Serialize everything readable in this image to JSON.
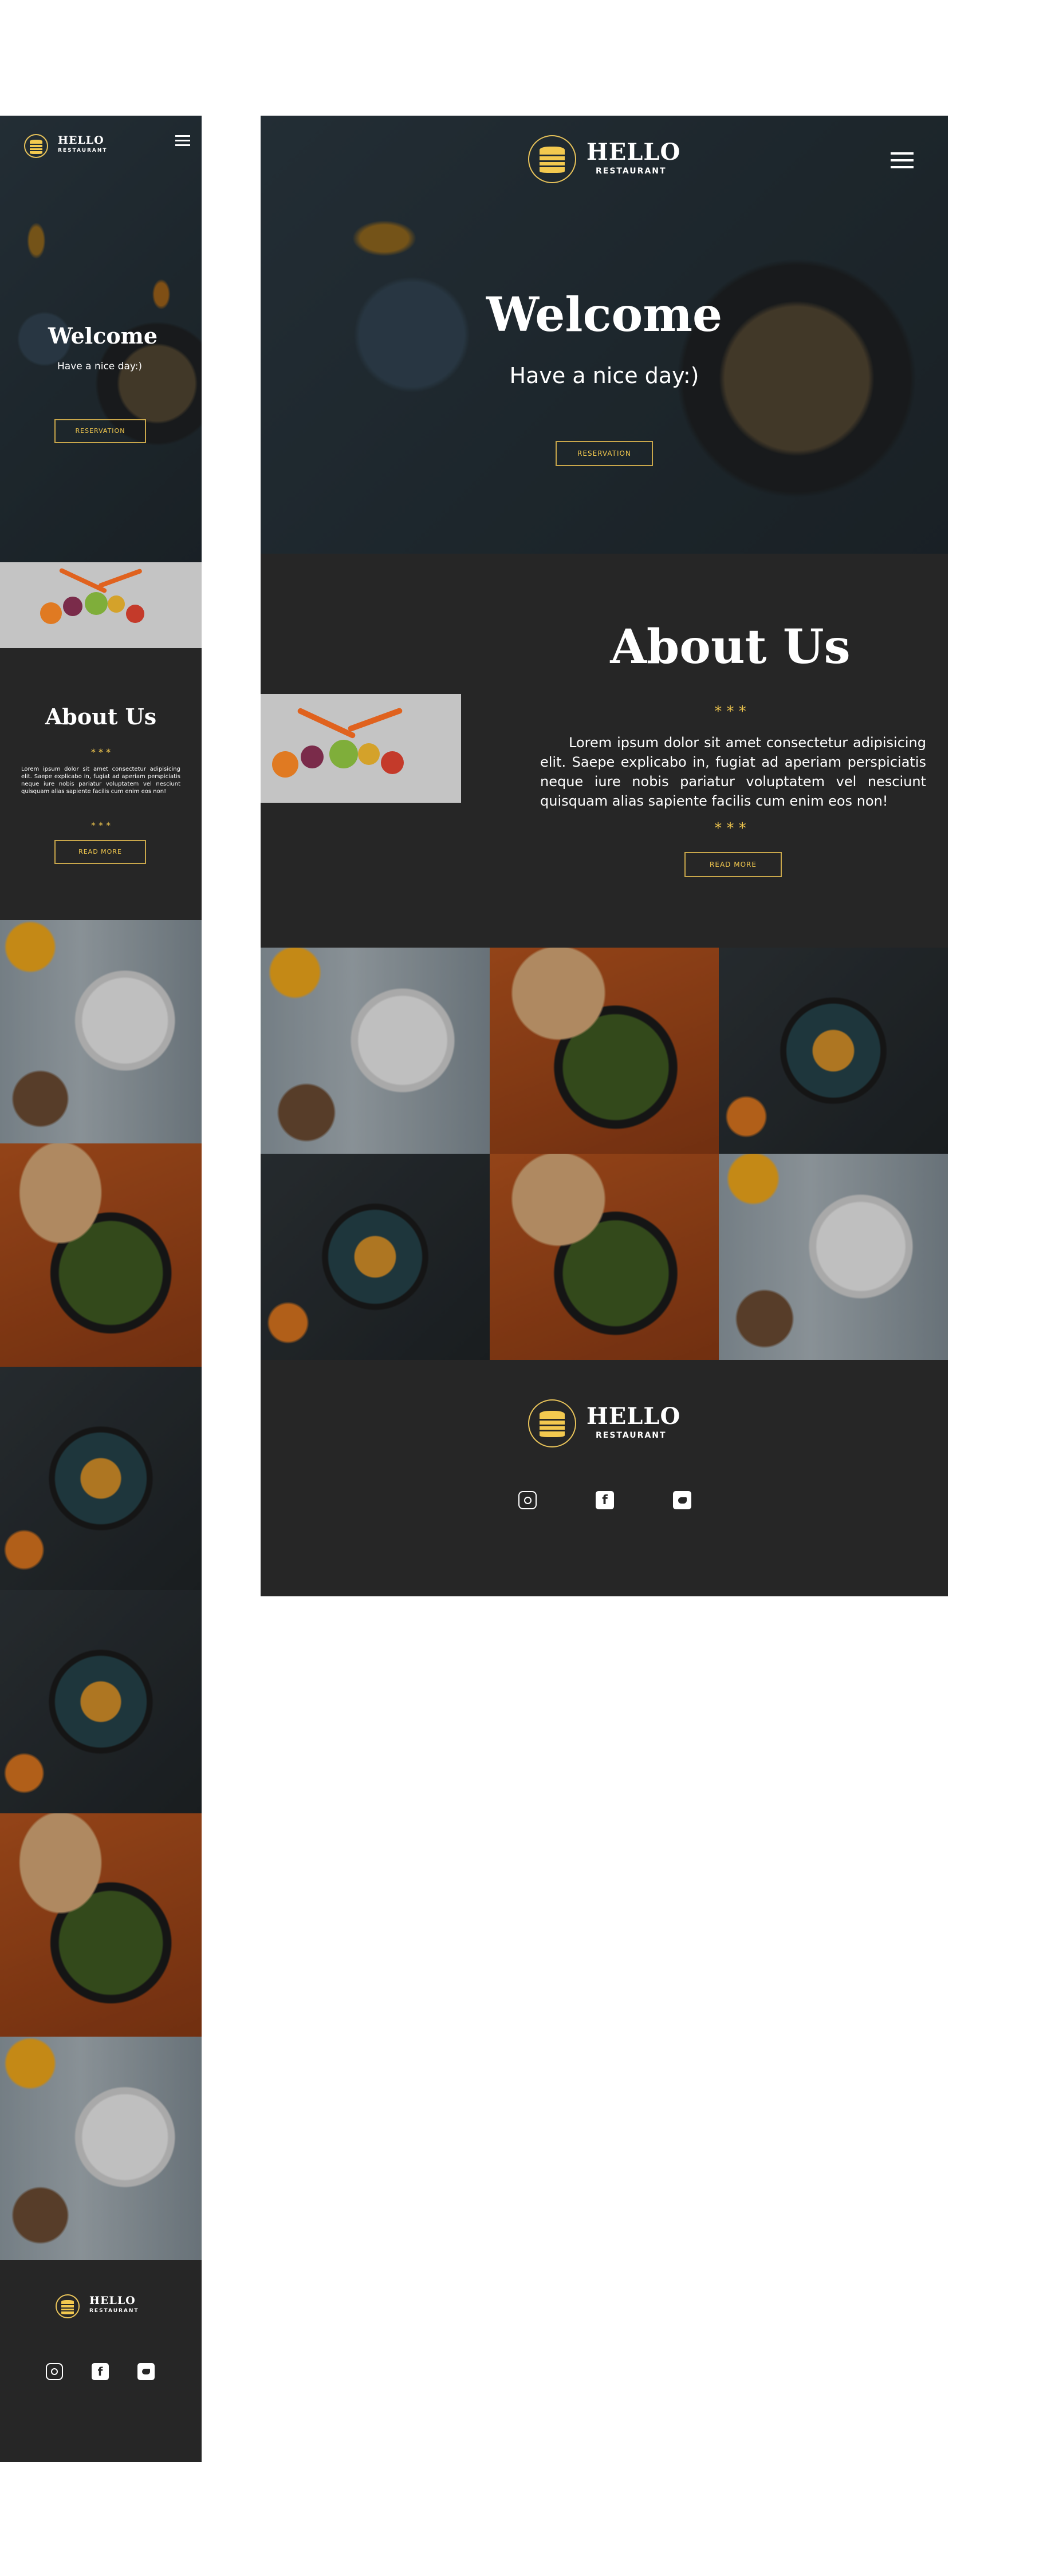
{
  "brand": {
    "name": "HELLO",
    "sub": "RESTAURANT"
  },
  "hero": {
    "title": "Welcome",
    "subtitle": "Have a nice day:)",
    "button": "RESERVATION"
  },
  "about": {
    "title": "About Us",
    "stars": "* * *",
    "body": "Lorem ipsum dolor sit amet consectetur adipisicing elit. Saepe explicabo in, fugiat ad aperiam perspiciatis neque iure nobis pariatur voluptatem vel nesciunt quisquam alias sapiente facilis cum enim eos non!",
    "button": "READ MORE"
  },
  "gallery": {
    "desktop": [
      "salad-bowl",
      "pita-greens",
      "pancakes",
      "pancakes",
      "pita-greens",
      "salad-bowl"
    ],
    "mobile": [
      "salad-bowl",
      "pita-greens",
      "pancakes",
      "pancakes",
      "pita-greens",
      "salad-bowl"
    ]
  },
  "social": {
    "instagram": "instagram-icon",
    "facebook": "f",
    "twitter": "twitter-icon"
  },
  "colors": {
    "background": "#262626",
    "accent": "#f3c94f",
    "text": "#ffffff"
  }
}
